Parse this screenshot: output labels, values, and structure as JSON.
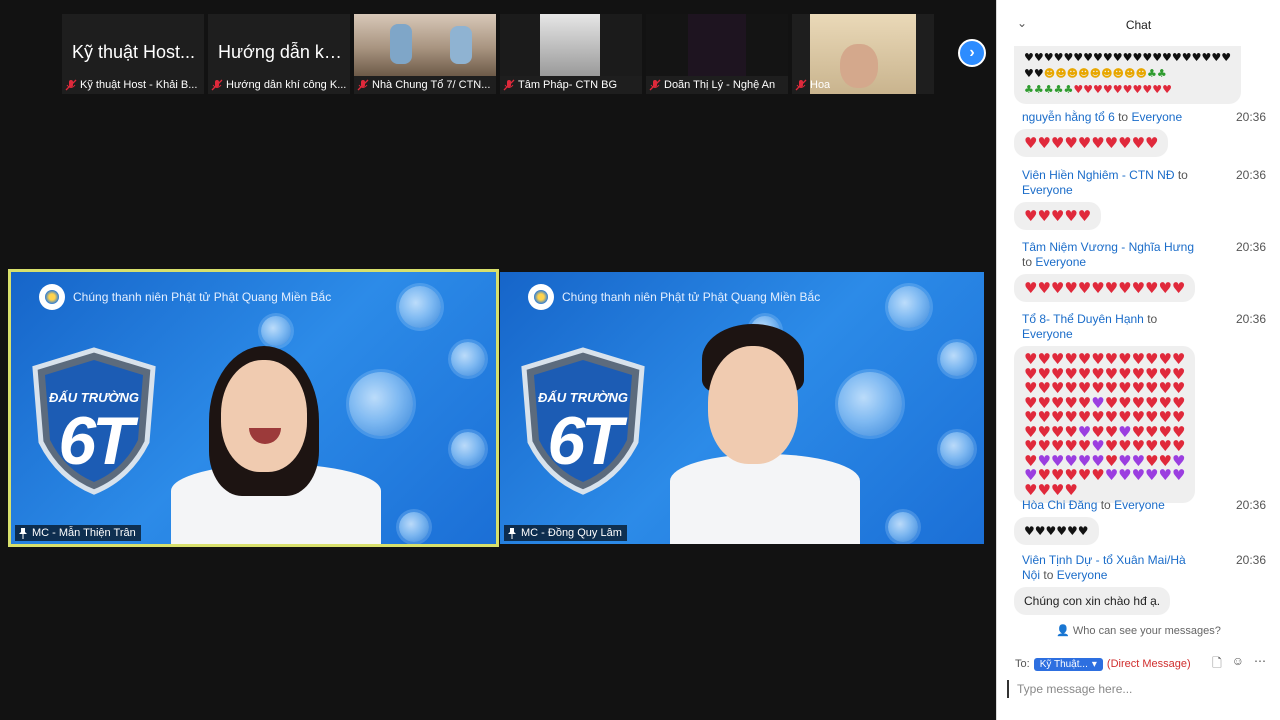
{
  "thumbnails": [
    {
      "big": "Kỹ thuật Host...",
      "caption": "Kỹ thuật Host - Khải B..."
    },
    {
      "big": "Hướng dẫn khí...",
      "caption": "Hướng dẫn khí công K..."
    },
    {
      "big": "",
      "caption": "Nhà Chung Tổ 7/ CTN..."
    },
    {
      "big": "",
      "caption": "Tâm Pháp- CTN BG"
    },
    {
      "big": "",
      "caption": "Doãn Thị Lý - Nghệ An"
    },
    {
      "big": "",
      "caption": "Hoa"
    }
  ],
  "strip_next_icon": "chevron-right-icon",
  "tiles": [
    {
      "name": "MC - Mẫn Thiện Trân",
      "banner": "Chúng thanh niên Phật tử Phật Quang Miền Bắc",
      "shield_top": "ĐẤU TRƯỜNG",
      "shield_big": "6T"
    },
    {
      "name": "MC - Đồng Quy Lâm",
      "banner": "Chúng thanh niên Phật tử Phật Quang Miền Bắc",
      "shield_top": "ĐẤU TRƯỜNG",
      "shield_big": "6T"
    }
  ],
  "chat": {
    "title": "Chat",
    "messages": [
      {
        "sender": "nguyễn hằng tổ 6",
        "to": "to",
        "recipient": "Everyone",
        "time": "20:36"
      },
      {
        "sender": "Viên Hiền Nghiêm - CTN NĐ",
        "to": "to",
        "recipient": "Everyone",
        "time": "20:36"
      },
      {
        "sender": "Tâm Niệm Vương - Nghĩa Hưng",
        "to": "to",
        "recipient": "Everyone",
        "time": "20:36"
      },
      {
        "sender": "Tổ 8- Thể Duyên Hạnh",
        "to": "to",
        "recipient": "Everyone",
        "time": "20:36"
      },
      {
        "sender": "Hòa Chi Đăng",
        "to": "to",
        "recipient": "Everyone",
        "time": "20:36"
      },
      {
        "sender": "Viên Tịnh Dự - tổ Xuân Mai/Hà Nội",
        "to": "to",
        "recipient": "Everyone",
        "time": "20:36",
        "text": "Chúng con xin chào hđ ạ."
      }
    ],
    "who_can_see": "Who can see your messages?",
    "to_label": "To:",
    "to_target": "Kỹ Thuật...",
    "direct_message": "(Direct Message)",
    "placeholder": "Type message here..."
  }
}
